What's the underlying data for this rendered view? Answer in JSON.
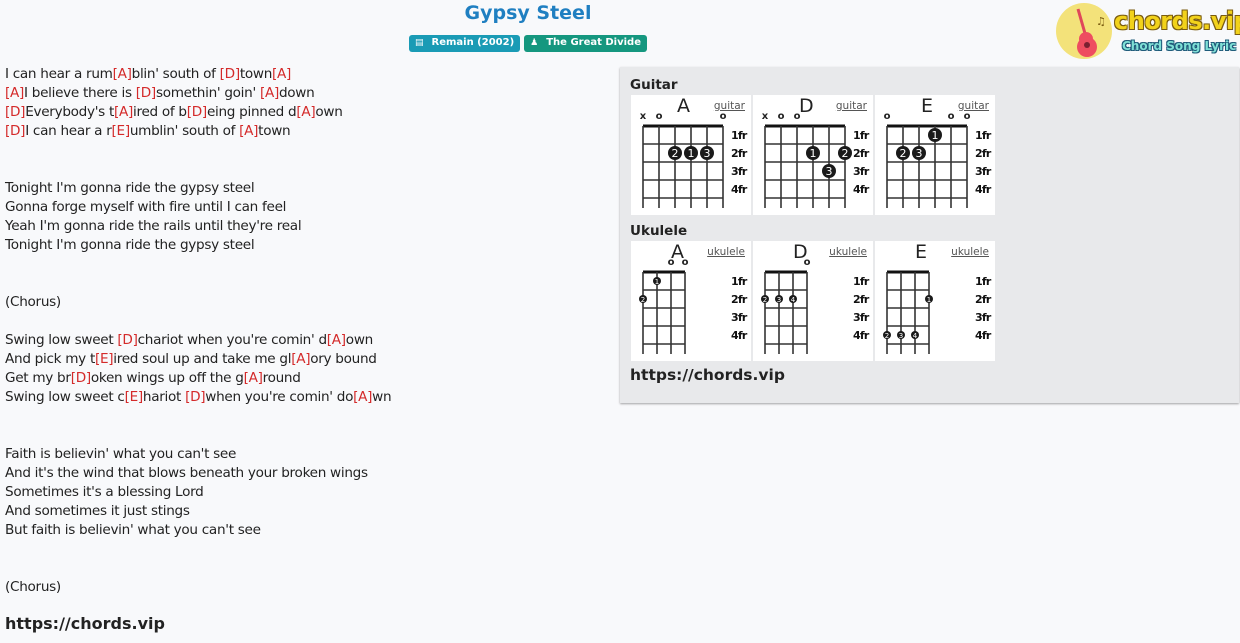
{
  "song": {
    "title": "Gypsy Steel",
    "album_badge": "Remain (2002)",
    "artist_badge": "The Great Divide",
    "album_icon": "book-icon",
    "artist_icon": "user-icon"
  },
  "logo": {
    "title": "chords.vip",
    "subtitle": "Chord Song Lyric",
    "icon": "guitar-icon"
  },
  "lyrics": [
    [
      {
        "t": "I can hear a rum"
      },
      {
        "c": "[A]"
      },
      {
        "t": "blin' south of "
      },
      {
        "c": "[D]"
      },
      {
        "t": "town"
      },
      {
        "c": "[A]"
      }
    ],
    [
      {
        "c": "[A]"
      },
      {
        "t": "I believe there is "
      },
      {
        "c": "[D]"
      },
      {
        "t": "somethin' goin' "
      },
      {
        "c": "[A]"
      },
      {
        "t": "down"
      }
    ],
    [
      {
        "c": "[D]"
      },
      {
        "t": "Everybody's t"
      },
      {
        "c": "[A]"
      },
      {
        "t": "ired of b"
      },
      {
        "c": "[D]"
      },
      {
        "t": "eing pinned d"
      },
      {
        "c": "[A]"
      },
      {
        "t": "own"
      }
    ],
    [
      {
        "c": "[D]"
      },
      {
        "t": "I can hear a r"
      },
      {
        "c": "[E]"
      },
      {
        "t": "umblin' south of "
      },
      {
        "c": "[A]"
      },
      {
        "t": "town"
      }
    ],
    [],
    [],
    [
      {
        "t": "Tonight I'm gonna ride the gypsy steel"
      }
    ],
    [
      {
        "t": "Gonna forge myself with fire until I can feel"
      }
    ],
    [
      {
        "t": "Yeah I'm gonna ride the rails until they're real"
      }
    ],
    [
      {
        "t": "Tonight I'm gonna ride the gypsy steel"
      }
    ],
    [],
    [],
    [
      {
        "t": "(Chorus)"
      }
    ],
    [],
    [
      {
        "t": "Swing low sweet "
      },
      {
        "c": "[D]"
      },
      {
        "t": "chariot when you're comin' d"
      },
      {
        "c": "[A]"
      },
      {
        "t": "own"
      }
    ],
    [
      {
        "t": "And pick my t"
      },
      {
        "c": "[E]"
      },
      {
        "t": "ired soul up and take me gl"
      },
      {
        "c": "[A]"
      },
      {
        "t": "ory bound"
      }
    ],
    [
      {
        "t": "Get my br"
      },
      {
        "c": "[D]"
      },
      {
        "t": "oken wings up off the g"
      },
      {
        "c": "[A]"
      },
      {
        "t": "round"
      }
    ],
    [
      {
        "t": "Swing low sweet c"
      },
      {
        "c": "[E]"
      },
      {
        "t": "hariot "
      },
      {
        "c": "[D]"
      },
      {
        "t": "when you're comin' do"
      },
      {
        "c": "[A]"
      },
      {
        "t": "wn"
      }
    ],
    [],
    [],
    [
      {
        "t": "Faith is believin' what you can't see"
      }
    ],
    [
      {
        "t": "And it's the wind that blows beneath your broken wings"
      }
    ],
    [
      {
        "t": "Sometimes it's a blessing Lord"
      }
    ],
    [
      {
        "t": "And sometimes it just stings"
      }
    ],
    [
      {
        "t": "But faith is believin' what you can't see"
      }
    ],
    [],
    [],
    [
      {
        "t": "(Chorus)"
      }
    ]
  ],
  "footer_url": "https://chords.vip",
  "panel": {
    "guitar_heading": "Guitar",
    "ukulele_heading": "Ukulele",
    "url": "https://chords.vip",
    "fret_labels": [
      "1fr",
      "2fr",
      "3fr",
      "4fr"
    ],
    "guitar": [
      {
        "name": "A",
        "link": "guitar",
        "open": [
          "x",
          "o",
          "",
          "",
          "",
          "o"
        ],
        "dots": [
          {
            "s": 3,
            "f": 2,
            "n": "2"
          },
          {
            "s": 4,
            "f": 2,
            "n": "1"
          },
          {
            "s": 5,
            "f": 2,
            "n": "3"
          }
        ]
      },
      {
        "name": "D",
        "link": "guitar",
        "open": [
          "x",
          "o",
          "o",
          "",
          "",
          ""
        ],
        "dots": [
          {
            "s": 4,
            "f": 2,
            "n": "1"
          },
          {
            "s": 6,
            "f": 2,
            "n": "2"
          },
          {
            "s": 5,
            "f": 3,
            "n": "3"
          }
        ]
      },
      {
        "name": "E",
        "link": "guitar",
        "open": [
          "o",
          "",
          "",
          "",
          "o",
          "o"
        ],
        "dots": [
          {
            "s": 4,
            "f": 1,
            "n": "1"
          },
          {
            "s": 2,
            "f": 2,
            "n": "2"
          },
          {
            "s": 3,
            "f": 2,
            "n": "3"
          }
        ]
      }
    ],
    "ukulele": [
      {
        "name": "A",
        "link": "ukulele",
        "open": [
          "",
          "",
          "o",
          "o"
        ],
        "dots": [
          {
            "s": 2,
            "f": 1,
            "n": "1"
          },
          {
            "s": 1,
            "f": 2,
            "n": "2"
          }
        ]
      },
      {
        "name": "D",
        "link": "ukulele",
        "open": [
          "",
          "",
          "",
          "o"
        ],
        "dots": [
          {
            "s": 1,
            "f": 2,
            "n": "2"
          },
          {
            "s": 2,
            "f": 2,
            "n": "3"
          },
          {
            "s": 3,
            "f": 2,
            "n": "4"
          }
        ]
      },
      {
        "name": "E",
        "link": "ukulele",
        "open": [
          "",
          "",
          "",
          ""
        ],
        "dots": [
          {
            "s": 4,
            "f": 2,
            "n": "1"
          },
          {
            "s": 1,
            "f": 4,
            "n": "2"
          },
          {
            "s": 2,
            "f": 4,
            "n": "3"
          },
          {
            "s": 3,
            "f": 4,
            "n": "4"
          }
        ]
      }
    ]
  }
}
